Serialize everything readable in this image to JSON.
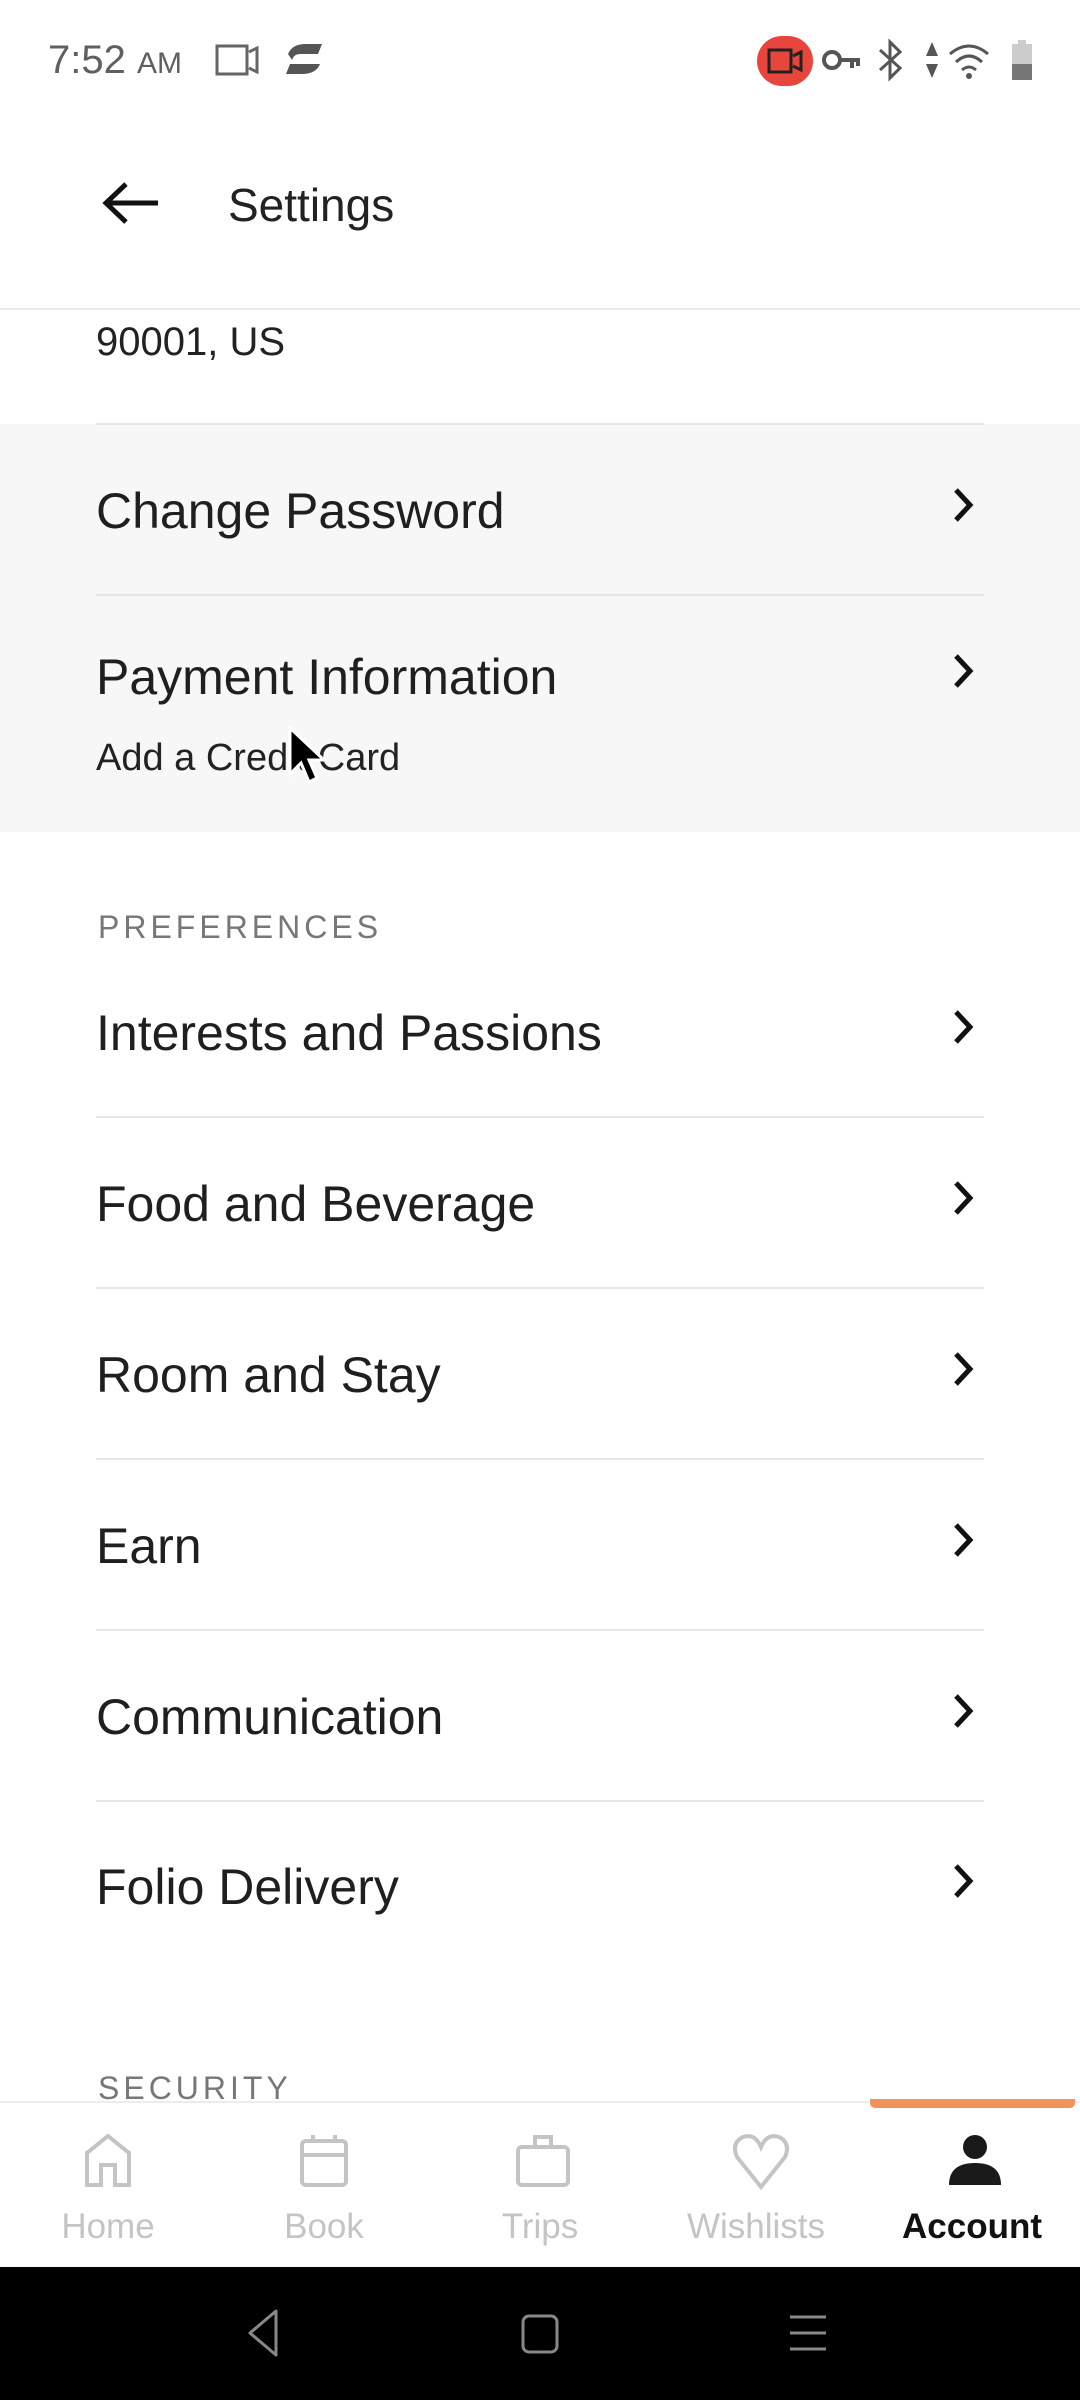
{
  "status_bar": {
    "time": "7:52",
    "ampm": "AM",
    "icons": [
      "screen-record-icon",
      "sync-icon",
      "camera-recording-icon",
      "vpn-key-icon",
      "bluetooth-icon",
      "data-arrows-icon",
      "wifi-icon",
      "battery-icon"
    ],
    "record_color": "#e8453c"
  },
  "header": {
    "title": "Settings",
    "back_icon": "arrow-left-icon"
  },
  "address_tail": "90001, US",
  "account_items": [
    {
      "label": "Change Password"
    },
    {
      "label": "Payment Information",
      "subtitle": "Add a Credit Card"
    }
  ],
  "preferences": {
    "header": "PREFERENCES",
    "items": [
      {
        "label": "Interests and Passions"
      },
      {
        "label": "Food and Beverage"
      },
      {
        "label": "Room and Stay"
      },
      {
        "label": "Earn"
      },
      {
        "label": "Communication"
      },
      {
        "label": "Folio Delivery"
      }
    ]
  },
  "security": {
    "header": "SECURITY"
  },
  "bottom_nav": {
    "active": "Account",
    "accent": "#f2915a",
    "items": [
      {
        "label": "Home",
        "icon": "home-icon"
      },
      {
        "label": "Book",
        "icon": "calendar-icon"
      },
      {
        "label": "Trips",
        "icon": "suitcase-icon"
      },
      {
        "label": "Wishlists",
        "icon": "heart-icon"
      },
      {
        "label": "Account",
        "icon": "person-icon"
      }
    ]
  }
}
